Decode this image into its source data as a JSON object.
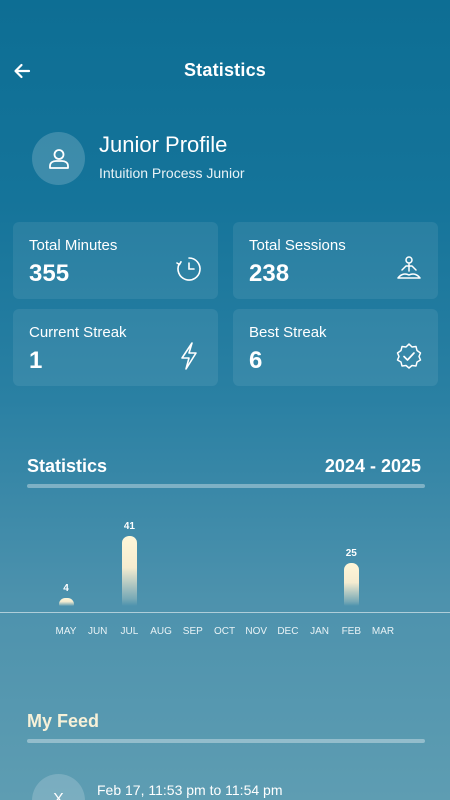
{
  "header": {
    "title": "Statistics",
    "back_icon": "arrow-left-icon"
  },
  "profile": {
    "name": "Junior Profile",
    "subtitle": "Intuition Process Junior",
    "avatar_icon": "user-icon"
  },
  "cards": [
    {
      "label": "Total Minutes",
      "value": "355",
      "icon": "timer-icon"
    },
    {
      "label": "Total Sessions",
      "value": "238",
      "icon": "meditation-icon"
    },
    {
      "label": "Current Streak",
      "value": "1",
      "icon": "lightning-icon"
    },
    {
      "label": "Best Streak",
      "value": "6",
      "icon": "badge-check-icon"
    }
  ],
  "statistics": {
    "title": "Statistics",
    "range": "2024 - 2025"
  },
  "chart_data": {
    "type": "bar",
    "categories": [
      "MAY",
      "JUN",
      "JUL",
      "AUG",
      "SEP",
      "OCT",
      "NOV",
      "DEC",
      "JAN",
      "FEB",
      "MAR"
    ],
    "values": [
      4,
      0,
      41,
      0,
      0,
      0,
      0,
      0,
      0,
      25,
      0
    ],
    "data_labels": [
      "4",
      "",
      "41",
      "",
      "",
      "",
      "",
      "",
      "",
      "25",
      ""
    ]
  },
  "feed": {
    "title": "My Feed",
    "items": [
      {
        "avatar_text": "X",
        "time": "Feb 17, 11:53 pm to 11:54 pm"
      }
    ]
  }
}
